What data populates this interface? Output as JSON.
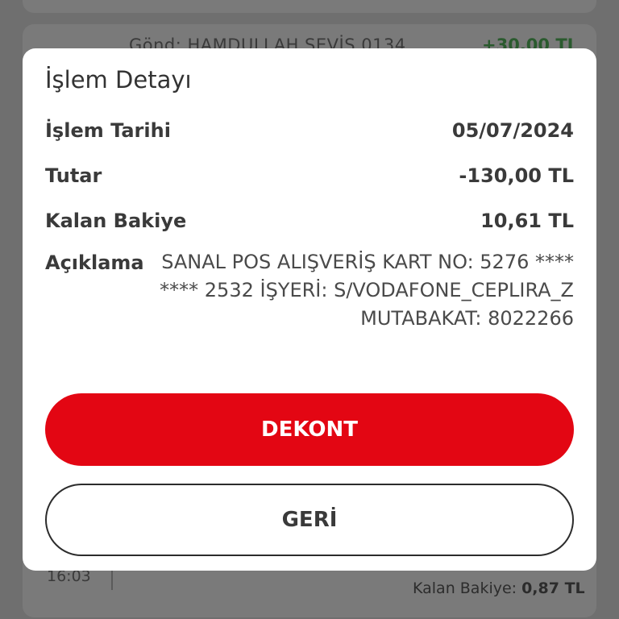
{
  "background": {
    "sender": "Gönd: HAMDULLAH SEVİŞ 0134",
    "amount": "+30,00 TL",
    "time": "16:03",
    "balance_label": "Kalan Bakiye:",
    "balance_value": "0,87 TL"
  },
  "modal": {
    "title": "İşlem Detayı",
    "rows": {
      "date": {
        "label": "İşlem Tarihi",
        "value": "05/07/2024"
      },
      "amount": {
        "label": "Tutar",
        "value": "-130,00 TL"
      },
      "balance": {
        "label": "Kalan Bakiye",
        "value": "10,61 TL"
      },
      "description": {
        "label": "Açıklama",
        "lines": [
          "SANAL POS ALIŞVERİŞ KART NO: 5276 ****",
          "**** 2532 İŞYERİ: S/VODAFONE_CEPLIRA_Z",
          "MUTABAKAT: 8022266"
        ]
      }
    },
    "buttons": {
      "primary": "DEKONT",
      "secondary": "GERİ"
    }
  },
  "colors": {
    "accent": "#e30613",
    "overlay": "#6f6f6f"
  }
}
